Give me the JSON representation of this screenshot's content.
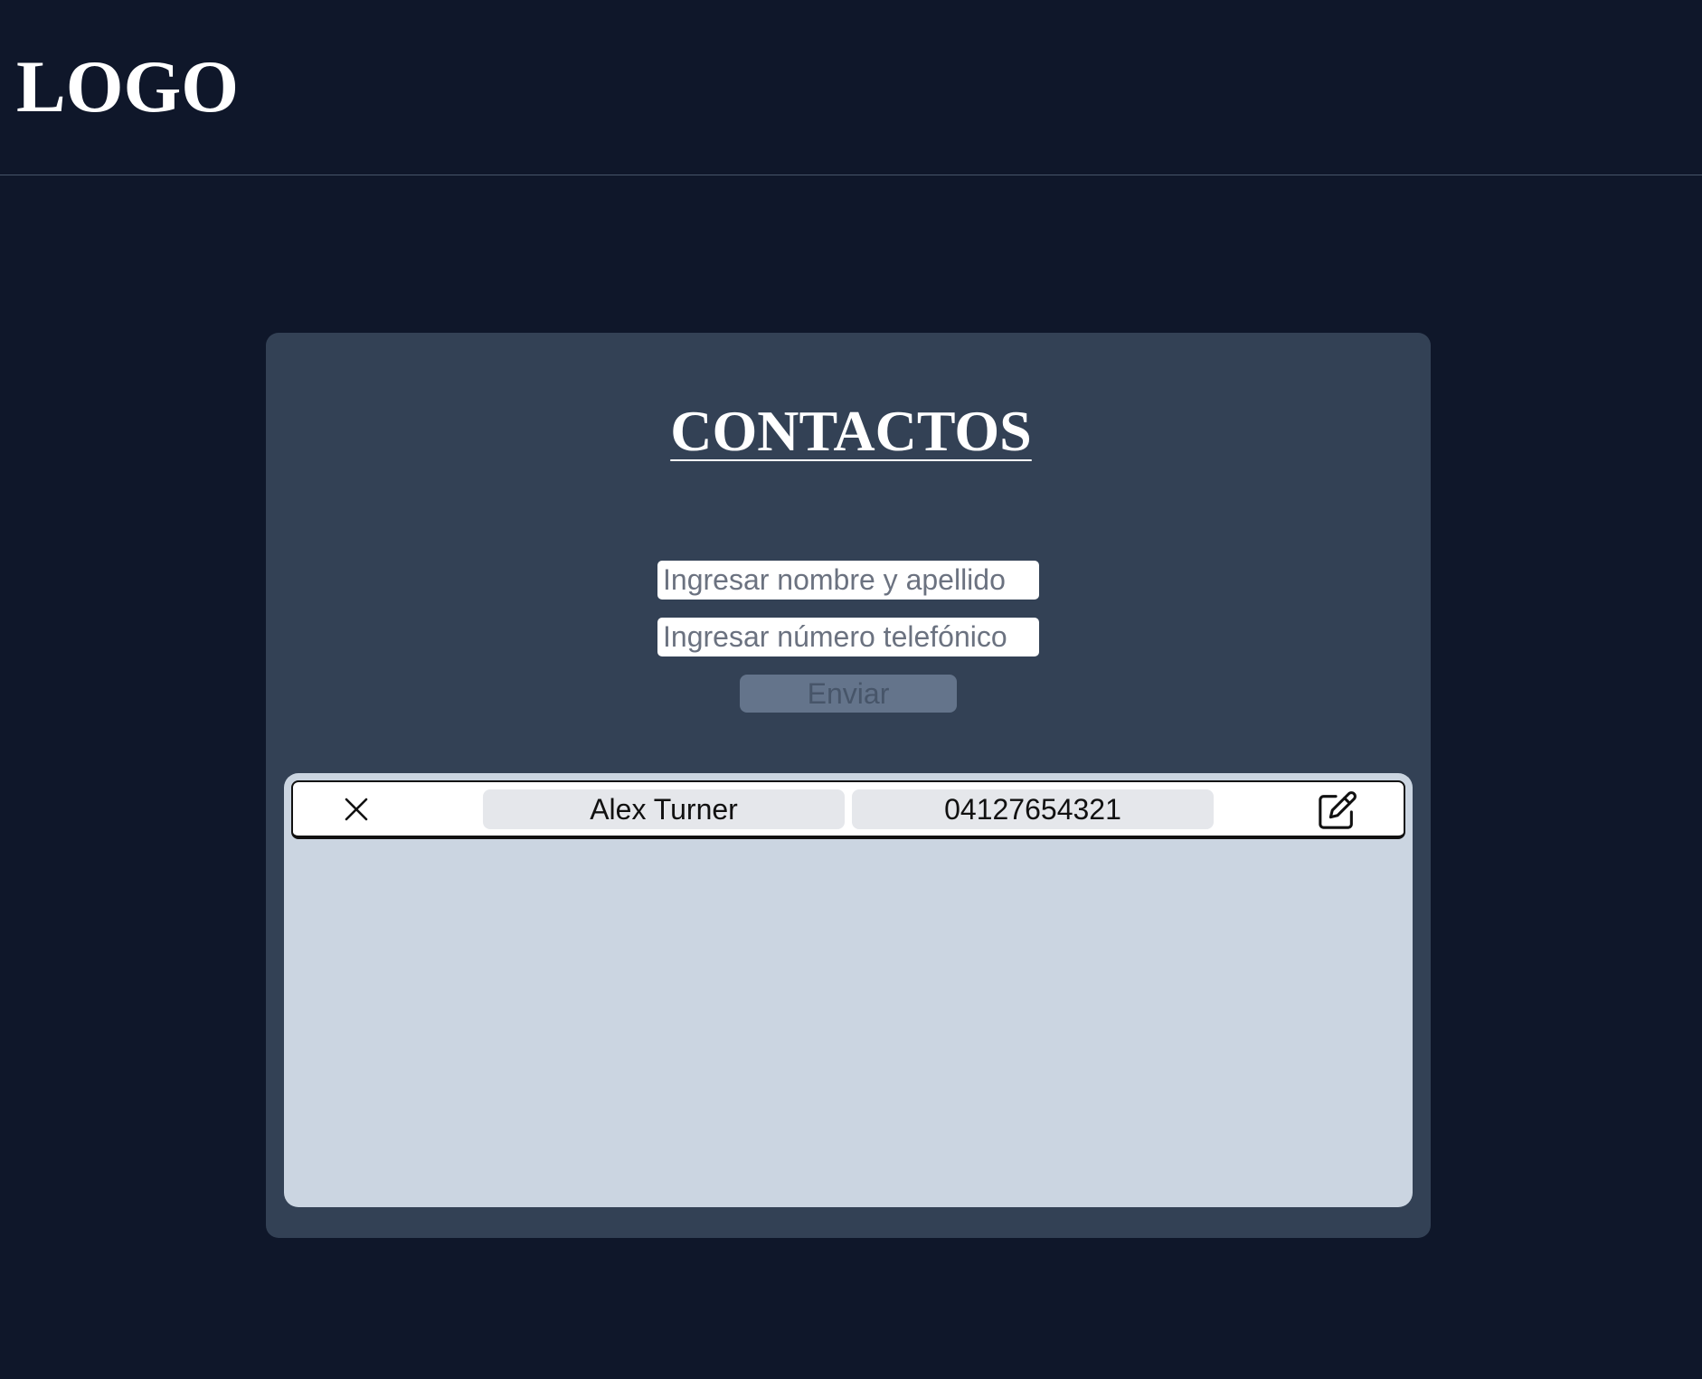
{
  "header": {
    "logo_text": "LOGO"
  },
  "main": {
    "title": "CONTACTOS",
    "form": {
      "name_placeholder": "Ingresar nombre y apellido",
      "name_value": "",
      "phone_placeholder": "Ingresar número telefónico",
      "phone_value": "",
      "submit_label": "Enviar"
    },
    "contacts": [
      {
        "name": "Alex Turner",
        "phone": "04127654321",
        "delete_icon": "close-icon",
        "edit_icon": "pencil-square-icon"
      }
    ]
  },
  "colors": {
    "page_background": "#0f172a",
    "card_background": "#334155",
    "list_background": "#cbd5e1",
    "submit_background": "#64748b"
  }
}
